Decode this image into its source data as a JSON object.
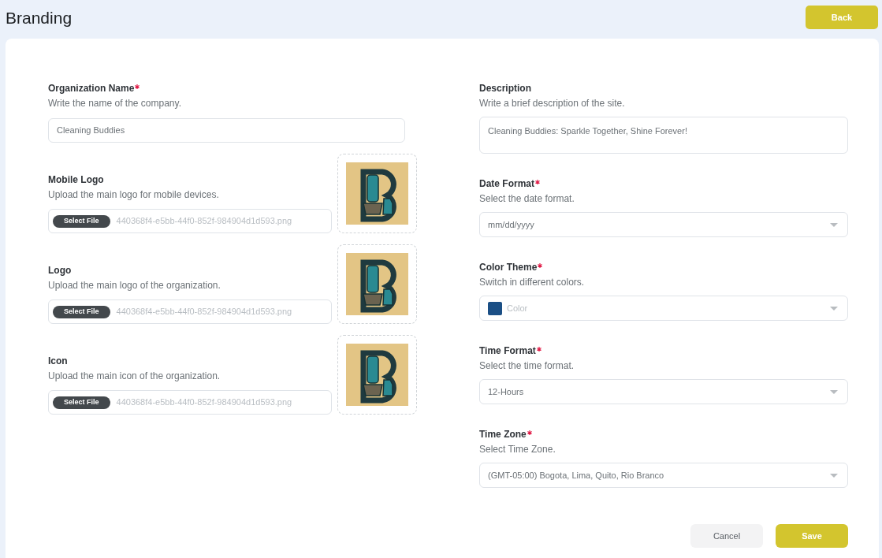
{
  "page": {
    "title": "Branding",
    "back_button": "Back"
  },
  "left_fields": [
    {
      "kind": "text",
      "label": "Organization Name",
      "required": true,
      "hint": "Write the name of the company.",
      "value": "Cleaning Buddies"
    },
    {
      "kind": "file",
      "label": "Mobile Logo",
      "required": false,
      "hint": "Upload the main logo for mobile devices.",
      "button": "Select File",
      "value": "440368f4-e5bb-44f0-852f-984904d1d593.png"
    },
    {
      "kind": "file",
      "label": "Logo",
      "required": false,
      "hint": "Upload the main logo of the organization.",
      "button": "Select File",
      "value": "440368f4-e5bb-44f0-852f-984904d1d593.png"
    },
    {
      "kind": "file",
      "label": "Icon",
      "required": false,
      "hint": "Upload the main icon of the organization.",
      "button": "Select File",
      "value": "440368f4-e5bb-44f0-852f-984904d1d593.png"
    }
  ],
  "right_fields": [
    {
      "kind": "textarea",
      "label": "Description",
      "required": false,
      "hint": "Write a brief description of the site.",
      "value": "Cleaning Buddies: Sparkle Together, Shine Forever!"
    },
    {
      "kind": "select",
      "label": "Date Format",
      "required": true,
      "hint": "Select the date format.",
      "value": "mm/dd/yyyy"
    },
    {
      "kind": "color",
      "label": "Color Theme",
      "required": true,
      "hint": "Switch in different colors.",
      "placeholder": "Color",
      "color": "#1b4f85"
    },
    {
      "kind": "select",
      "label": "Time Format",
      "required": true,
      "hint": "Select the time format.",
      "value": "12-Hours"
    },
    {
      "kind": "select",
      "label": "Time Zone",
      "required": true,
      "hint": "Select Time Zone.",
      "value": "(GMT-05:00) Bogota, Lima, Quito, Rio Branco"
    }
  ],
  "actions": {
    "cancel": "Cancel",
    "save": "Save"
  }
}
